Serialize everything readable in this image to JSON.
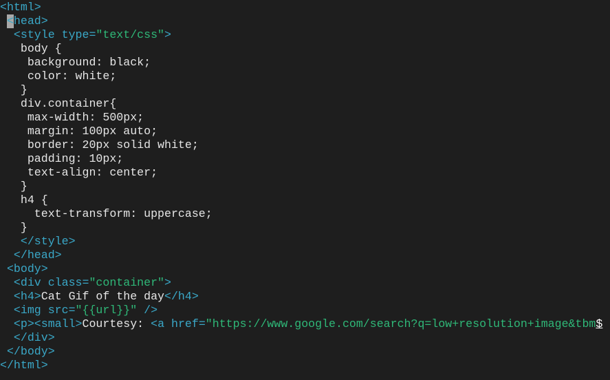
{
  "editor": {
    "colors": {
      "tag": "#3aa8c8",
      "string": "#2fb878",
      "text": "#e6e6e6",
      "background": "#1e1e1e"
    },
    "cursor": {
      "line": 2,
      "column": 1
    },
    "truncation_marker": "$",
    "lines": [
      {
        "indent": 0,
        "segments": [
          [
            "t",
            "<html>"
          ]
        ]
      },
      {
        "indent": 1,
        "segments": [
          [
            "t",
            "<head>"
          ]
        ]
      },
      {
        "indent": 2,
        "segments": [
          [
            "t",
            "<style type="
          ],
          [
            "s",
            "\"text/css\""
          ],
          [
            "t",
            ">"
          ]
        ]
      },
      {
        "indent": 3,
        "segments": [
          [
            "x",
            "body {"
          ]
        ]
      },
      {
        "indent": 4,
        "segments": [
          [
            "x",
            "background: black;"
          ]
        ]
      },
      {
        "indent": 4,
        "segments": [
          [
            "x",
            "color: white;"
          ]
        ]
      },
      {
        "indent": 3,
        "segments": [
          [
            "x",
            "}"
          ]
        ]
      },
      {
        "indent": 3,
        "segments": [
          [
            "x",
            "div.container{"
          ]
        ]
      },
      {
        "indent": 4,
        "segments": [
          [
            "x",
            "max-width: 500px;"
          ]
        ]
      },
      {
        "indent": 4,
        "segments": [
          [
            "x",
            "margin: 100px auto;"
          ]
        ]
      },
      {
        "indent": 4,
        "segments": [
          [
            "x",
            "border: 20px solid white;"
          ]
        ]
      },
      {
        "indent": 4,
        "segments": [
          [
            "x",
            "padding: 10px;"
          ]
        ]
      },
      {
        "indent": 4,
        "segments": [
          [
            "x",
            "text-align: center;"
          ]
        ]
      },
      {
        "indent": 3,
        "segments": [
          [
            "x",
            "}"
          ]
        ]
      },
      {
        "indent": 3,
        "segments": [
          [
            "x",
            "h4 {"
          ]
        ]
      },
      {
        "indent": 5,
        "segments": [
          [
            "x",
            "text-transform: uppercase;"
          ]
        ]
      },
      {
        "indent": 3,
        "segments": [
          [
            "x",
            "}"
          ]
        ]
      },
      {
        "indent": 3,
        "segments": [
          [
            "t",
            "</style>"
          ]
        ]
      },
      {
        "indent": 2,
        "segments": [
          [
            "t",
            "</head>"
          ]
        ]
      },
      {
        "indent": 1,
        "segments": [
          [
            "t",
            "<body>"
          ]
        ]
      },
      {
        "indent": 2,
        "segments": [
          [
            "t",
            "<div class="
          ],
          [
            "s",
            "\"container\""
          ],
          [
            "t",
            ">"
          ]
        ]
      },
      {
        "indent": 2,
        "segments": [
          [
            "t",
            "<h4>"
          ],
          [
            "x",
            "Cat Gif of the day"
          ],
          [
            "t",
            "</h4>"
          ]
        ]
      },
      {
        "indent": 2,
        "segments": [
          [
            "t",
            "<img src="
          ],
          [
            "s",
            "\"{{url}}\""
          ],
          [
            "t",
            " />"
          ]
        ]
      },
      {
        "indent": 2,
        "segments": [
          [
            "t",
            "<p><small>"
          ],
          [
            "x",
            "Courtesy: "
          ],
          [
            "t",
            "<a href="
          ],
          [
            "s",
            "\"https://www.google.com/search?q=low+resolution+image&tbm"
          ]
        ],
        "truncated": true
      },
      {
        "indent": 2,
        "segments": [
          [
            "t",
            "</div>"
          ]
        ]
      },
      {
        "indent": 1,
        "segments": [
          [
            "t",
            "</body>"
          ]
        ]
      },
      {
        "indent": 0,
        "segments": [
          [
            "t",
            "</html>"
          ]
        ]
      }
    ]
  }
}
